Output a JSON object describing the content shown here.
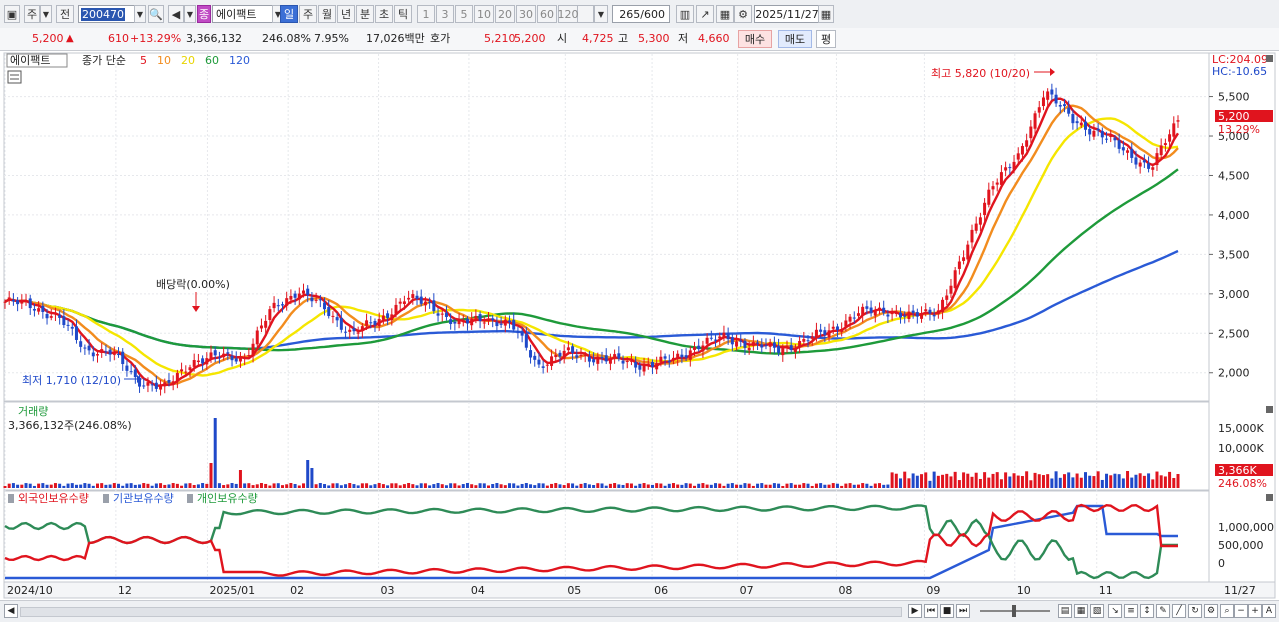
{
  "toolbar": {
    "mode_left": "주",
    "mode_right": "전",
    "code": "200470",
    "name_badge": "종",
    "stock_name": "에이팩트",
    "periods": [
      "일",
      "주",
      "월",
      "년",
      "분",
      "초",
      "틱"
    ],
    "active_period": "일",
    "intervals": [
      "1",
      "3",
      "5",
      "10",
      "20",
      "30",
      "60",
      "120"
    ],
    "count_value": "265",
    "count_total": "/600",
    "date": "2025/11/27"
  },
  "quote": {
    "price": "5,200",
    "arrow": "▲",
    "change": "610",
    "change_pct": "+13.29%",
    "volume": "3,366,132",
    "volume_ratio": "246.08%",
    "turnover": "7.95%",
    "amount": "17,026백만",
    "bid_label": "호가",
    "bid1": "5,210",
    "bid2": "5,200",
    "open_label": "시",
    "open": "4,725",
    "high_label": "고",
    "high": "5,300",
    "low_label": "저",
    "low": "4,660",
    "buy_label": "매수",
    "sell_label": "매도",
    "eval_label": "평"
  },
  "price_pane": {
    "legend_name": "에이팩트",
    "legend_type": "종가 단순",
    "ma_labels": [
      {
        "label": "5",
        "color": "#e0141e"
      },
      {
        "label": "10",
        "color": "#f28c1e"
      },
      {
        "label": "20",
        "color": "#e8d400"
      },
      {
        "label": "60",
        "color": "#1e9a3a"
      },
      {
        "label": "120",
        "color": "#2a5ad6"
      }
    ],
    "lc": "LC:204.09",
    "hc": "HC:-10.65",
    "y_ticks": [
      "5,500",
      "5,000",
      "4,500",
      "4,000",
      "3,500",
      "3,000",
      "2,500",
      "2,000"
    ],
    "last_price_tag": "5,200",
    "last_pct_tag": "13.29%",
    "high_annotation": "최고 5,820 (10/20)",
    "low_annotation": "최저 1,710 (12/10)",
    "dividend_annotation": "배당락(0.00%)"
  },
  "volume_pane": {
    "title": "거래량",
    "value": "3,366,132주(246.08%)",
    "y_ticks": [
      "15,000K",
      "10,000K"
    ],
    "last_tag": "3,366K",
    "last_pct": "246.08%"
  },
  "holding_pane": {
    "legend": [
      {
        "label": "외국인보유수량",
        "color": "#e0141e"
      },
      {
        "label": "기관보유수량",
        "color": "#2a5ad6"
      },
      {
        "label": "개인보유수량",
        "color": "#1e9a3a"
      }
    ],
    "y_ticks": [
      "1,000,000",
      "500,000",
      "0"
    ]
  },
  "x_axis": {
    "labels": [
      "2024/10",
      "12",
      "2025/01",
      "02",
      "03",
      "04",
      "05",
      "06",
      "07",
      "08",
      "09",
      "10",
      "11",
      "11/27"
    ]
  },
  "colors": {
    "up": "#e0141e",
    "down": "#1f49c9",
    "ma5": "#e0141e",
    "ma10": "#f28c1e",
    "ma20": "#f5e600",
    "ma60": "#1e9a3a",
    "ma120": "#2a5ad6"
  },
  "chart_data": {
    "type": "candlestick",
    "period": "daily",
    "x_start": "2024/10",
    "x_end": "2025/11/27",
    "ylim": [
      1700,
      5900
    ],
    "close_path": [
      [
        "2024/10",
        2900
      ],
      [
        "2024/10",
        2850
      ],
      [
        "2024/11",
        2700
      ],
      [
        "2024/11",
        2300
      ],
      [
        "2024/11",
        2250
      ],
      [
        "2024/12",
        1900
      ],
      [
        "2024/12/10",
        1800
      ],
      [
        "2024/12",
        2150
      ],
      [
        "2024/12",
        2200
      ],
      [
        "2025/01",
        2200
      ],
      [
        "2025/01",
        2800
      ],
      [
        "2025/01",
        3050
      ],
      [
        "2025/02",
        2800
      ],
      [
        "2025/02",
        2500
      ],
      [
        "2025/02",
        2650
      ],
      [
        "2025/02",
        2950
      ],
      [
        "2025/03",
        2850
      ],
      [
        "2025/03",
        2600
      ],
      [
        "2025/03",
        2700
      ],
      [
        "2025/04",
        2600
      ],
      [
        "2025/04",
        2100
      ],
      [
        "2025/04",
        2250
      ],
      [
        "2025/05",
        2200
      ],
      [
        "2025/05",
        2150
      ],
      [
        "2025/05",
        2100
      ],
      [
        "2025/06",
        2150
      ],
      [
        "2025/06",
        2350
      ],
      [
        "2025/06",
        2450
      ],
      [
        "2025/07",
        2350
      ],
      [
        "2025/07",
        2300
      ],
      [
        "2025/07",
        2400
      ],
      [
        "2025/08",
        2550
      ],
      [
        "2025/08",
        2750
      ],
      [
        "2025/08",
        2800
      ],
      [
        "2025/09",
        2700
      ],
      [
        "2025/09",
        2800
      ],
      [
        "2025/09",
        3500
      ],
      [
        "2025/09",
        4400
      ],
      [
        "2025/10",
        4700
      ],
      [
        "2025/10/20",
        5600
      ],
      [
        "2025/10",
        5200
      ],
      [
        "2025/11",
        5050
      ],
      [
        "2025/11",
        4800
      ],
      [
        "2025/11",
        4600
      ],
      [
        "2025/11/27",
        5200
      ]
    ],
    "high_point": {
      "date": "2025/10/20",
      "value": 5820
    },
    "low_point": {
      "date": "2024/12/10",
      "value": 1710
    },
    "last_close": 5200
  }
}
